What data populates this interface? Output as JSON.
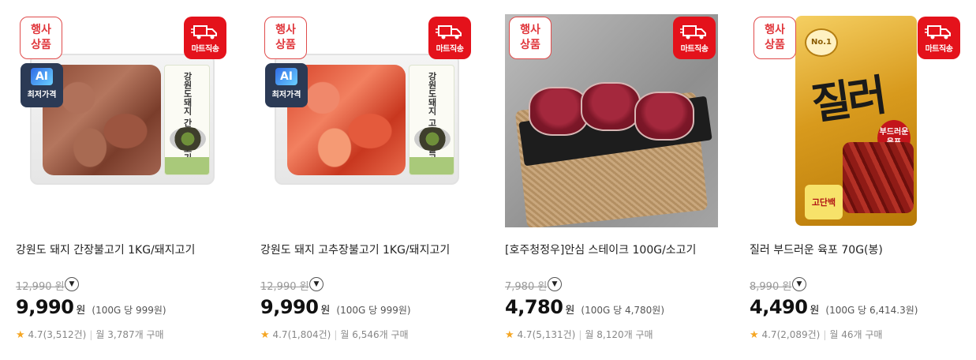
{
  "badges": {
    "event_line1": "행사",
    "event_line2": "상품",
    "mart": "마트직송",
    "ai_title": "AI",
    "ai_sub": "최저가격"
  },
  "package_text": {
    "pork_soy": "강원도돼지 간장불고기",
    "pork_hot": "강원도돼지 고추장불고기",
    "jerky_title": "질러",
    "jerky_sub_1": "부드러운",
    "jerky_sub_2": "육포",
    "jerky_no1": "No.1",
    "jerky_protein": "고단백"
  },
  "products": [
    {
      "name": "강원도 돼지 간장불고기 1KG/돼지고기",
      "original_price": "12,990 원",
      "price": "9,990",
      "currency": "원",
      "unit_price": "(100G 당 999원)",
      "rating": "4.7",
      "reviews": "(3,512건)",
      "monthly": "월 3,787개 구매"
    },
    {
      "name": "강원도 돼지 고추장불고기 1KG/돼지고기",
      "original_price": "12,990 원",
      "price": "9,990",
      "currency": "원",
      "unit_price": "(100G 당 999원)",
      "rating": "4.7",
      "reviews": "(1,804건)",
      "monthly": "월 6,546개 구매"
    },
    {
      "name": "[호주청정우]안심 스테이크 100G/소고기",
      "original_price": "7,980 원",
      "price": "4,780",
      "currency": "원",
      "unit_price": "(100G 당 4,780원)",
      "rating": "4.7",
      "reviews": "(5,131건)",
      "monthly": "월 8,120개 구매"
    },
    {
      "name": "질러 부드러운 육포 70G(봉)",
      "original_price": "8,990 원",
      "price": "4,490",
      "currency": "원",
      "unit_price": "(100G 당 6,414.3원)",
      "rating": "4.7",
      "reviews": "(2,089건)",
      "monthly": "월 46개 구매"
    }
  ],
  "colors": {
    "event_red": "#e0363b",
    "mart_red": "#e4121b",
    "star": "#f5a623"
  }
}
